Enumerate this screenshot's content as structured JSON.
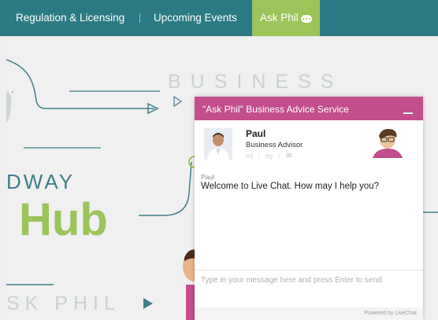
{
  "nav": {
    "items": [
      {
        "label": "Regulation & Licensing"
      },
      {
        "label": "Upcoming Events"
      },
      {
        "label": "Ask Phil",
        "icon": "chat-bubble-icon"
      }
    ]
  },
  "hero": {
    "business_text": "BUSINESS",
    "dway_text": "DWAY",
    "hub_text": "Hub",
    "ask_phil_text": "SK PHIL"
  },
  "chat": {
    "title": "\"Ask Phil\" Business Advice Service",
    "agent_name": "Paul",
    "agent_role": "Business Advisor",
    "message_author": "Paul",
    "message_text": "Welcome to Live Chat. How may I help you?",
    "input_placeholder": "Type in your message here and press Enter to send",
    "powered_by": "Powered by LiveChat"
  },
  "colors": {
    "nav_bg": "#2c7a85",
    "nav_active": "#9bc45a",
    "chat_header": "#c44d8e"
  }
}
